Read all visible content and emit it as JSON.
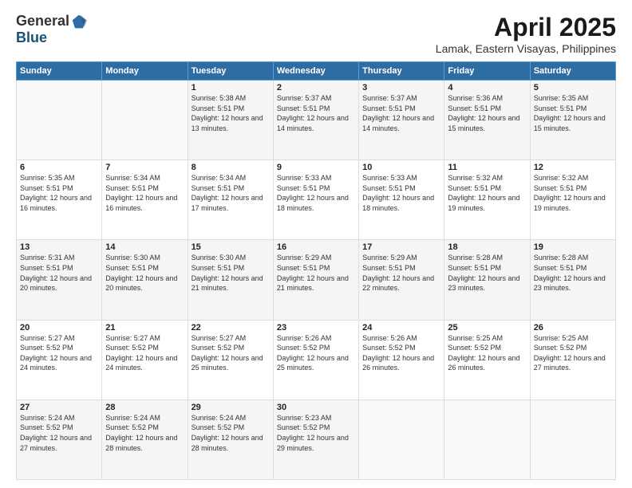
{
  "logo": {
    "general": "General",
    "blue": "Blue"
  },
  "title": "April 2025",
  "subtitle": "Lamak, Eastern Visayas, Philippines",
  "days_of_week": [
    "Sunday",
    "Monday",
    "Tuesday",
    "Wednesday",
    "Thursday",
    "Friday",
    "Saturday"
  ],
  "weeks": [
    [
      {
        "day": "",
        "info": ""
      },
      {
        "day": "",
        "info": ""
      },
      {
        "day": "1",
        "info": "Sunrise: 5:38 AM\nSunset: 5:51 PM\nDaylight: 12 hours and 13 minutes."
      },
      {
        "day": "2",
        "info": "Sunrise: 5:37 AM\nSunset: 5:51 PM\nDaylight: 12 hours and 14 minutes."
      },
      {
        "day": "3",
        "info": "Sunrise: 5:37 AM\nSunset: 5:51 PM\nDaylight: 12 hours and 14 minutes."
      },
      {
        "day": "4",
        "info": "Sunrise: 5:36 AM\nSunset: 5:51 PM\nDaylight: 12 hours and 15 minutes."
      },
      {
        "day": "5",
        "info": "Sunrise: 5:35 AM\nSunset: 5:51 PM\nDaylight: 12 hours and 15 minutes."
      }
    ],
    [
      {
        "day": "6",
        "info": "Sunrise: 5:35 AM\nSunset: 5:51 PM\nDaylight: 12 hours and 16 minutes."
      },
      {
        "day": "7",
        "info": "Sunrise: 5:34 AM\nSunset: 5:51 PM\nDaylight: 12 hours and 16 minutes."
      },
      {
        "day": "8",
        "info": "Sunrise: 5:34 AM\nSunset: 5:51 PM\nDaylight: 12 hours and 17 minutes."
      },
      {
        "day": "9",
        "info": "Sunrise: 5:33 AM\nSunset: 5:51 PM\nDaylight: 12 hours and 18 minutes."
      },
      {
        "day": "10",
        "info": "Sunrise: 5:33 AM\nSunset: 5:51 PM\nDaylight: 12 hours and 18 minutes."
      },
      {
        "day": "11",
        "info": "Sunrise: 5:32 AM\nSunset: 5:51 PM\nDaylight: 12 hours and 19 minutes."
      },
      {
        "day": "12",
        "info": "Sunrise: 5:32 AM\nSunset: 5:51 PM\nDaylight: 12 hours and 19 minutes."
      }
    ],
    [
      {
        "day": "13",
        "info": "Sunrise: 5:31 AM\nSunset: 5:51 PM\nDaylight: 12 hours and 20 minutes."
      },
      {
        "day": "14",
        "info": "Sunrise: 5:30 AM\nSunset: 5:51 PM\nDaylight: 12 hours and 20 minutes."
      },
      {
        "day": "15",
        "info": "Sunrise: 5:30 AM\nSunset: 5:51 PM\nDaylight: 12 hours and 21 minutes."
      },
      {
        "day": "16",
        "info": "Sunrise: 5:29 AM\nSunset: 5:51 PM\nDaylight: 12 hours and 21 minutes."
      },
      {
        "day": "17",
        "info": "Sunrise: 5:29 AM\nSunset: 5:51 PM\nDaylight: 12 hours and 22 minutes."
      },
      {
        "day": "18",
        "info": "Sunrise: 5:28 AM\nSunset: 5:51 PM\nDaylight: 12 hours and 23 minutes."
      },
      {
        "day": "19",
        "info": "Sunrise: 5:28 AM\nSunset: 5:51 PM\nDaylight: 12 hours and 23 minutes."
      }
    ],
    [
      {
        "day": "20",
        "info": "Sunrise: 5:27 AM\nSunset: 5:52 PM\nDaylight: 12 hours and 24 minutes."
      },
      {
        "day": "21",
        "info": "Sunrise: 5:27 AM\nSunset: 5:52 PM\nDaylight: 12 hours and 24 minutes."
      },
      {
        "day": "22",
        "info": "Sunrise: 5:27 AM\nSunset: 5:52 PM\nDaylight: 12 hours and 25 minutes."
      },
      {
        "day": "23",
        "info": "Sunrise: 5:26 AM\nSunset: 5:52 PM\nDaylight: 12 hours and 25 minutes."
      },
      {
        "day": "24",
        "info": "Sunrise: 5:26 AM\nSunset: 5:52 PM\nDaylight: 12 hours and 26 minutes."
      },
      {
        "day": "25",
        "info": "Sunrise: 5:25 AM\nSunset: 5:52 PM\nDaylight: 12 hours and 26 minutes."
      },
      {
        "day": "26",
        "info": "Sunrise: 5:25 AM\nSunset: 5:52 PM\nDaylight: 12 hours and 27 minutes."
      }
    ],
    [
      {
        "day": "27",
        "info": "Sunrise: 5:24 AM\nSunset: 5:52 PM\nDaylight: 12 hours and 27 minutes."
      },
      {
        "day": "28",
        "info": "Sunrise: 5:24 AM\nSunset: 5:52 PM\nDaylight: 12 hours and 28 minutes."
      },
      {
        "day": "29",
        "info": "Sunrise: 5:24 AM\nSunset: 5:52 PM\nDaylight: 12 hours and 28 minutes."
      },
      {
        "day": "30",
        "info": "Sunrise: 5:23 AM\nSunset: 5:52 PM\nDaylight: 12 hours and 29 minutes."
      },
      {
        "day": "",
        "info": ""
      },
      {
        "day": "",
        "info": ""
      },
      {
        "day": "",
        "info": ""
      }
    ]
  ]
}
